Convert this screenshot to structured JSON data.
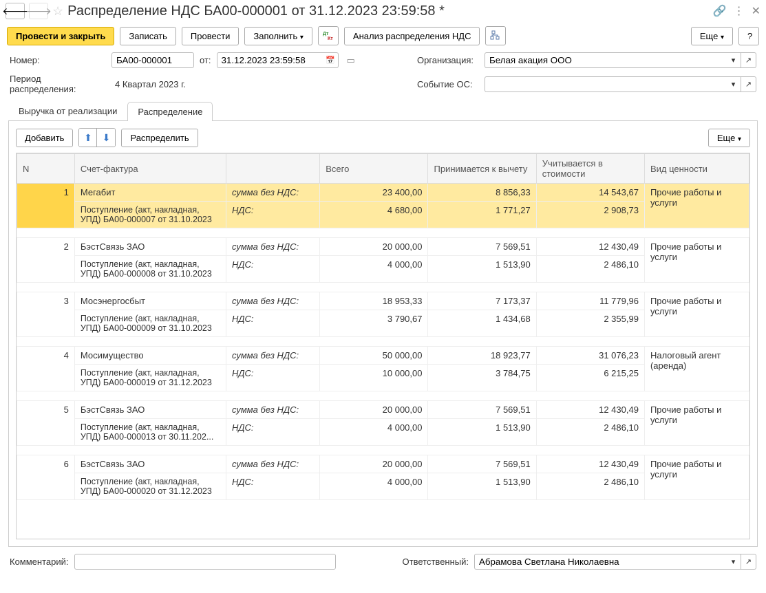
{
  "title": "Распределение НДС БА00-000001 от 31.12.2023 23:59:58 *",
  "toolbar": {
    "post_close": "Провести и закрыть",
    "save": "Записать",
    "post": "Провести",
    "fill": "Заполнить",
    "analysis": "Анализ распределения НДС",
    "more": "Еще",
    "help": "?"
  },
  "form": {
    "number_label": "Номер:",
    "number_value": "БА00-000001",
    "from_label": "от:",
    "date_value": "31.12.2023 23:59:58",
    "org_label": "Организация:",
    "org_value": "Белая акация ООО",
    "period_label": "Период распределения:",
    "period_value": "4 Квартал 2023  г.",
    "event_label": "Событие ОС:",
    "event_value": ""
  },
  "tabs": {
    "revenue": "Выручка от реализации",
    "distribution": "Распределение"
  },
  "panel_toolbar": {
    "add": "Добавить",
    "distribute": "Распределить",
    "more": "Еще"
  },
  "headers": {
    "n": "N",
    "sf": "Счет-фактура",
    "total": "Всего",
    "deduct": "Принимается к вычету",
    "cost": "Учитывается в стоимости",
    "type": "Вид ценности"
  },
  "row_labels": {
    "sum_no_vat": "сумма без НДС:",
    "vat": "НДС:"
  },
  "rows": [
    {
      "n": "1",
      "counterparty": "Мегабит",
      "doc": "Поступление (акт, накладная, УПД) БА00-000007 от 31.10.2023",
      "total_sum": "23 400,00",
      "total_vat": "4 680,00",
      "deduct_sum": "8 856,33",
      "deduct_vat": "1 771,27",
      "cost_sum": "14 543,67",
      "cost_vat": "2 908,73",
      "type": "Прочие работы и услуги",
      "selected": true
    },
    {
      "n": "2",
      "counterparty": "БэстСвязь ЗАО",
      "doc": "Поступление (акт, накладная, УПД) БА00-000008 от 31.10.2023",
      "total_sum": "20 000,00",
      "total_vat": "4 000,00",
      "deduct_sum": "7 569,51",
      "deduct_vat": "1 513,90",
      "cost_sum": "12 430,49",
      "cost_vat": "2 486,10",
      "type": "Прочие работы и услуги"
    },
    {
      "n": "3",
      "counterparty": "Мосэнергосбыт",
      "doc": "Поступление (акт, накладная, УПД) БА00-000009 от 31.10.2023",
      "total_sum": "18 953,33",
      "total_vat": "3 790,67",
      "deduct_sum": "7 173,37",
      "deduct_vat": "1 434,68",
      "cost_sum": "11 779,96",
      "cost_vat": "2 355,99",
      "type": "Прочие работы и услуги"
    },
    {
      "n": "4",
      "counterparty": "Мосимущество",
      "doc": "Поступление (акт, накладная, УПД) БА00-000019 от 31.12.2023",
      "total_sum": "50 000,00",
      "total_vat": "10 000,00",
      "deduct_sum": "18 923,77",
      "deduct_vat": "3 784,75",
      "cost_sum": "31 076,23",
      "cost_vat": "6 215,25",
      "type": "Налоговый агент (аренда)"
    },
    {
      "n": "5",
      "counterparty": "БэстСвязь ЗАО",
      "doc": "Поступление (акт, накладная, УПД) БА00-000013 от 30.11.202...",
      "total_sum": "20 000,00",
      "total_vat": "4 000,00",
      "deduct_sum": "7 569,51",
      "deduct_vat": "1 513,90",
      "cost_sum": "12 430,49",
      "cost_vat": "2 486,10",
      "type": "Прочие работы и услуги"
    },
    {
      "n": "6",
      "counterparty": "БэстСвязь ЗАО",
      "doc": "Поступление (акт, накладная, УПД) БА00-000020 от 31.12.2023",
      "total_sum": "20 000,00",
      "total_vat": "4 000,00",
      "deduct_sum": "7 569,51",
      "deduct_vat": "1 513,90",
      "cost_sum": "12 430,49",
      "cost_vat": "2 486,10",
      "type": "Прочие работы и услуги"
    }
  ],
  "bottom": {
    "comment_label": "Комментарий:",
    "comment_value": "",
    "responsible_label": "Ответственный:",
    "responsible_value": "Абрамова Светлана Николаевна"
  }
}
